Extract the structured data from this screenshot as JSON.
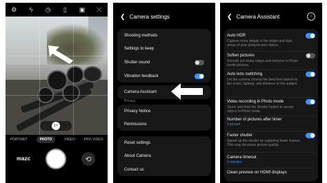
{
  "camera": {
    "top_icons": [
      "gear-icon",
      "flash-icon",
      "timer-icon",
      "aspect-ratio-icon",
      "motion-photo-icon",
      "filter-icon"
    ],
    "top_icon_glyphs": [
      "⚙",
      "ϟ",
      "◷",
      "▯",
      "▣",
      "⤫"
    ],
    "zoom_label": "1×",
    "modes": [
      "PORTRAIT",
      "PHOTO",
      "VIDEO",
      "PRO VIDEO"
    ],
    "active_mode": "PHOTO",
    "thumbnail_label": "mazc",
    "flip_glyph": "⟲"
  },
  "camera_settings": {
    "title": "Camera settings",
    "items_group1": [
      {
        "label": "Shooting methods"
      },
      {
        "label": "Settings to keep"
      },
      {
        "label": "Shutter sound",
        "toggle": "off"
      },
      {
        "label": "Vibration feedback",
        "toggle": "on"
      }
    ],
    "camera_assistant": "Camera Assistant",
    "privacy_header": "Privacy",
    "privacy_items": [
      "Privacy Notice",
      "Permissions"
    ],
    "bottom_items": [
      "Reset settings",
      "About Camera",
      "Contact us"
    ]
  },
  "camera_assistant": {
    "title": "Camera Assistant",
    "items": [
      {
        "title": "Auto HDR",
        "desc": "Capture more details in the bright and dark areas of your pictures and videos.",
        "toggle": "on"
      },
      {
        "title": "Soften pictures",
        "desc": "Smooth out sharp edges and textures in Photo mode pictures.",
        "toggle": "off"
      },
      {
        "title": "Auto lens switching",
        "desc": "Let the camera choose the best lens based on the zoom, lighting, and distance to the subject.",
        "toggle": "on"
      },
      {
        "title": "Video recording in Photo mode",
        "desc": "Touch and hold the Shutter button to record videos in Photo mode.",
        "toggle": "on"
      },
      {
        "title": "Number of pictures after timer",
        "value": "1 picture"
      },
      {
        "title": "Faster shutter",
        "desc": "Speed up the shutter by capturing fewer frames. This may decrease picture quality.",
        "toggle": "on"
      },
      {
        "title": "Camera timeout",
        "value": "2 minutes"
      },
      {
        "title": "Clean preview on HDMI displays"
      }
    ]
  },
  "colors": {
    "accent": "#3e91ff",
    "background": "#000000",
    "card": "#171717"
  }
}
